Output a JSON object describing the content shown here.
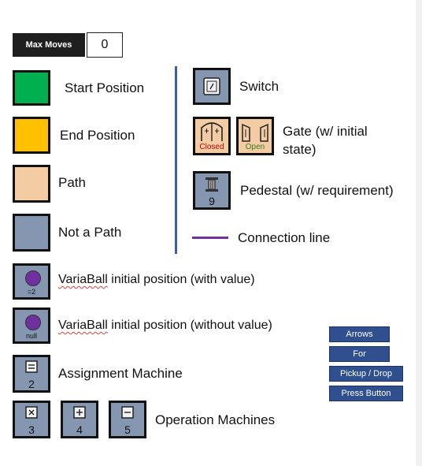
{
  "max_moves": {
    "label": "Max Moves",
    "value": "0"
  },
  "legend_left": {
    "start": "Start Position",
    "end": "End Position",
    "path": "Path",
    "not_path": "Not a Path"
  },
  "legend_right": {
    "switch": "Switch",
    "gate_line1": "Gate (w/ initial",
    "gate_line2": "state)",
    "gate_closed": "Closed",
    "gate_open": "Open",
    "pedestal": "Pedestal (w/ requirement)",
    "pedestal_num": "9",
    "connection": "Connection line"
  },
  "varaball": {
    "with_value_label": "VariaBall initial position (with value)",
    "with_value_word": "VariaBall",
    "with_value_rest": " initial position (with value)",
    "with_value_tag": "=2",
    "without_value_word": "VariaBall",
    "without_value_rest": " initial position (without value)",
    "without_value_tag": "null"
  },
  "machines": {
    "assignment": "Assignment Machine",
    "assignment_num": "2",
    "operation": "Operation Machines",
    "op_nums": [
      "3",
      "4",
      "5"
    ]
  },
  "buttons": [
    "Arrows",
    "For",
    "Pickup / Drop",
    "Press Button"
  ],
  "colors": {
    "start": "#00b050",
    "end": "#ffc000",
    "path": "#f4cca4",
    "not_path": "#8496b0",
    "accent_line": "#3a5ea8",
    "connection": "#7030a0",
    "button_bg": "#2f4f8f"
  }
}
